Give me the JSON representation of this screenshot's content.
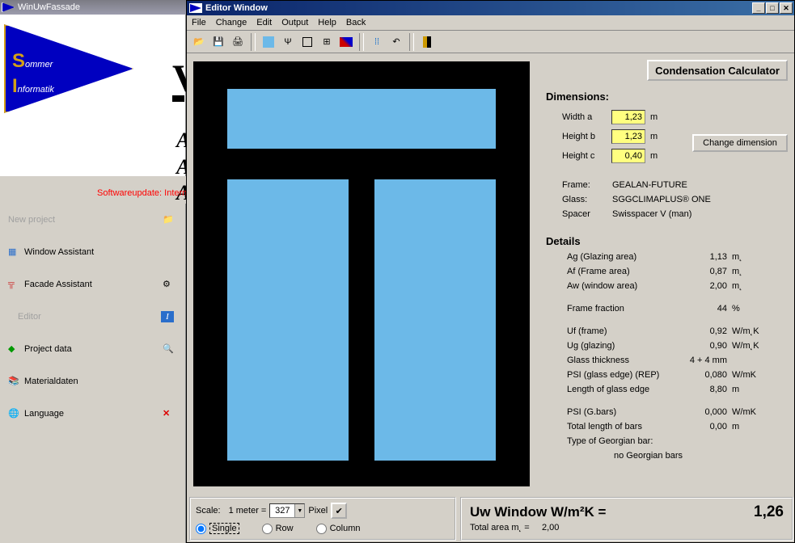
{
  "main_title": "WinUwFassade",
  "logo": {
    "line1_big": "S",
    "line1_rest": "ommer",
    "line2_big": "I",
    "line2_rest": "nformatik"
  },
  "update_msg": "Softwareupdate: Internetco",
  "sidebar": {
    "items": [
      {
        "label": "New project",
        "disabled": true
      },
      {
        "label": "Window Assistant",
        "disabled": false
      },
      {
        "label": "Facade Assistant",
        "disabled": false
      },
      {
        "label": "Editor",
        "disabled": true
      },
      {
        "label": "Project data",
        "disabled": false
      },
      {
        "label": "Materialdaten",
        "disabled": false
      },
      {
        "label": "Language",
        "disabled": false
      }
    ]
  },
  "editor": {
    "title": "Editor Window",
    "menus": [
      "File",
      "Change",
      "Edit",
      "Output",
      "Help",
      "Back"
    ],
    "calc_button": "Condensation Calculator",
    "dimensions_title": "Dimensions:",
    "dims": [
      {
        "label": "Width a",
        "value": "1,23",
        "unit": "m"
      },
      {
        "label": "Height b",
        "value": "1,23",
        "unit": "m"
      },
      {
        "label": "Height c",
        "value": "0,40",
        "unit": "m"
      }
    ],
    "change_dim_btn": "Change dimension",
    "info": [
      {
        "k": "Frame:",
        "v": "GEALAN-FUTURE"
      },
      {
        "k": "Glass:",
        "v": "SGGCLIMAPLUS® ONE"
      },
      {
        "k": "Spacer",
        "v": "Swisspacer V (man)"
      }
    ],
    "details_title": "Details",
    "details": [
      {
        "k": "Ag (Glazing area)",
        "v": "1,13",
        "u": "m˛"
      },
      {
        "k": "Af (Frame area)",
        "v": "0,87",
        "u": "m˛"
      },
      {
        "k": "Aw (window area)",
        "v": "2,00",
        "u": "m˛"
      },
      "gap",
      {
        "k": "Frame fraction",
        "v": "44",
        "u": "%"
      },
      "gap",
      {
        "k": "Uf (frame)",
        "v": "0,92",
        "u": "W/m˛K"
      },
      {
        "k": "Ug (glazing)",
        "v": "0,90",
        "u": "W/m˛K"
      },
      {
        "k": "Glass thickness",
        "v": "4 + 4 mm",
        "u": ""
      },
      {
        "k": "PSI (glass edge)   (REP)",
        "v": "0,080",
        "u": "W/mK"
      },
      {
        "k": "Length of glass edge",
        "v": "8,80",
        "u": "m"
      },
      "gap",
      {
        "k": "PSI (G.bars)",
        "v": "0,000",
        "u": "W/mK"
      },
      {
        "k": "Total length of bars",
        "v": "0,00",
        "u": "m"
      },
      {
        "k": "Type of Georgian bar:",
        "v": "",
        "u": ""
      },
      {
        "k_indent": "no Georgian bars",
        "v": "",
        "u": ""
      }
    ],
    "scale_label": "Scale:",
    "scale_meter": "1 meter =",
    "scale_value": "327",
    "scale_unit": "Pixel",
    "radios": {
      "single": "Single",
      "row": "Row",
      "column": "Column"
    },
    "uw_label": "Uw Window W/m²K  =",
    "uw_value": "1,26",
    "total_area_label": "Total area m˛ =",
    "total_area_value": "2,00"
  }
}
